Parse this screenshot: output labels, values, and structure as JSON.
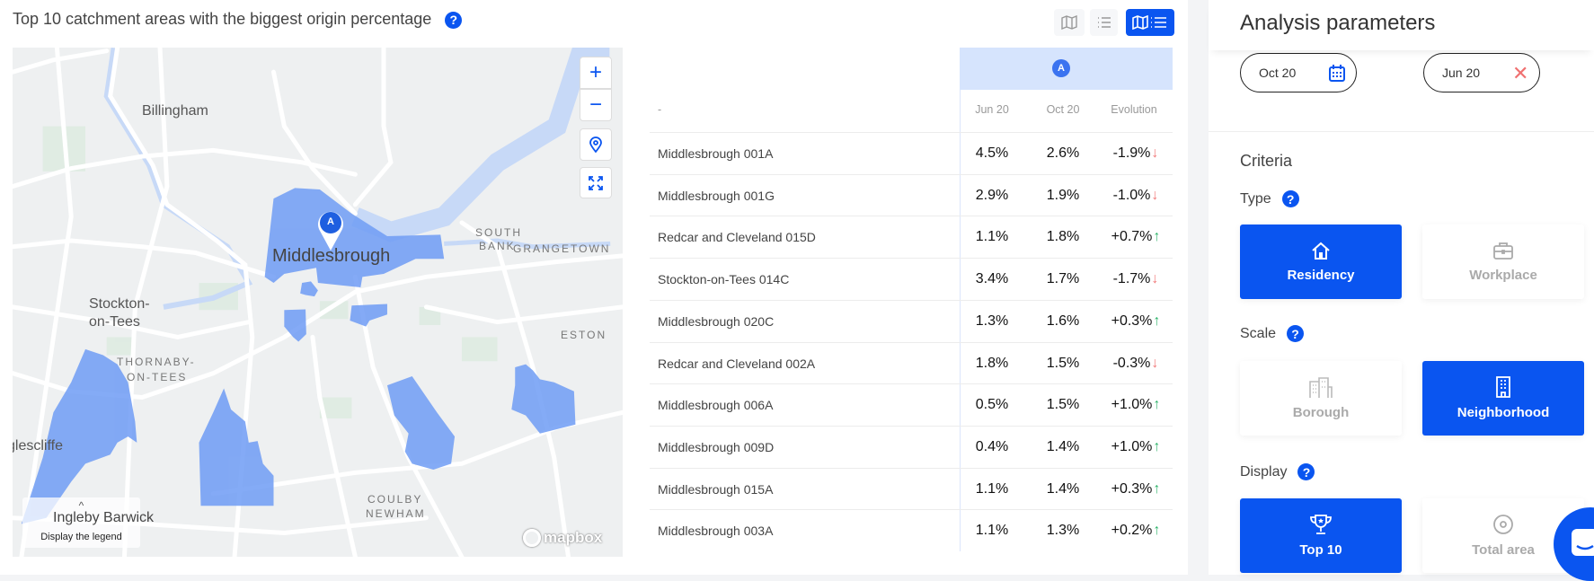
{
  "title": "Top 10 catchment areas with the biggest origin percentage",
  "view_toggles": [
    {
      "icon": "map-icon",
      "active": false
    },
    {
      "icon": "list-icon",
      "active": false
    },
    {
      "icon": "map-list-icon",
      "active": true
    }
  ],
  "map": {
    "labels": {
      "billingham": "Billingham",
      "middlesbrough": "Middlesbrough",
      "south": "SOUTH",
      "bank": "BANK",
      "grangetown": "GRANGETOWN",
      "stockton1": "Stockton-",
      "stockton2": "on-Tees",
      "thornaby1": "THORNABY-",
      "thornaby2": "ON-TEES",
      "eston": "ESTON",
      "eaglescliffe": "glescliffe",
      "coulby": "COULBY",
      "newham": "NEWHAM",
      "ingleby": "Ingleby Barwick"
    },
    "marker": "A",
    "legend_label": "Display the legend",
    "attribution": "mapbox",
    "highlight_color": "#6f9cf5"
  },
  "table": {
    "group_label": "A",
    "name_header": "-",
    "columns": [
      "Jun 20",
      "Oct 20",
      "Evolution"
    ],
    "rows": [
      {
        "name": "Middlesbrough 001A",
        "jun": "4.5%",
        "oct": "2.6%",
        "evo": "-1.9%",
        "dir": "down"
      },
      {
        "name": "Middlesbrough 001G",
        "jun": "2.9%",
        "oct": "1.9%",
        "evo": "-1.0%",
        "dir": "down"
      },
      {
        "name": "Redcar and Cleveland 015D",
        "jun": "1.1%",
        "oct": "1.8%",
        "evo": "+0.7%",
        "dir": "up"
      },
      {
        "name": "Stockton-on-Tees 014C",
        "jun": "3.4%",
        "oct": "1.7%",
        "evo": "-1.7%",
        "dir": "down"
      },
      {
        "name": "Middlesbrough 020C",
        "jun": "1.3%",
        "oct": "1.6%",
        "evo": "+0.3%",
        "dir": "up"
      },
      {
        "name": "Redcar and Cleveland 002A",
        "jun": "1.8%",
        "oct": "1.5%",
        "evo": "-0.3%",
        "dir": "down"
      },
      {
        "name": "Middlesbrough 006A",
        "jun": "0.5%",
        "oct": "1.5%",
        "evo": "+1.0%",
        "dir": "up"
      },
      {
        "name": "Middlesbrough 009D",
        "jun": "0.4%",
        "oct": "1.4%",
        "evo": "+1.0%",
        "dir": "up"
      },
      {
        "name": "Middlesbrough 015A",
        "jun": "1.1%",
        "oct": "1.4%",
        "evo": "+0.3%",
        "dir": "up"
      },
      {
        "name": "Middlesbrough 003A",
        "jun": "1.1%",
        "oct": "1.3%",
        "evo": "+0.2%",
        "dir": "up"
      }
    ],
    "up_color": "#2fb36b",
    "down_color": "#f07a7a"
  },
  "panel": {
    "title": "Analysis parameters",
    "date1": "Oct 20",
    "date2": "Jun 20",
    "criteria": "Criteria",
    "type_label": "Type",
    "type_options": [
      "Residency",
      "Workplace"
    ],
    "scale_label": "Scale",
    "scale_options": [
      "Borough",
      "Neighborhood"
    ],
    "display_label": "Display",
    "display_options": [
      "Top 10",
      "Total area"
    ]
  },
  "accent": "#0a55f0"
}
